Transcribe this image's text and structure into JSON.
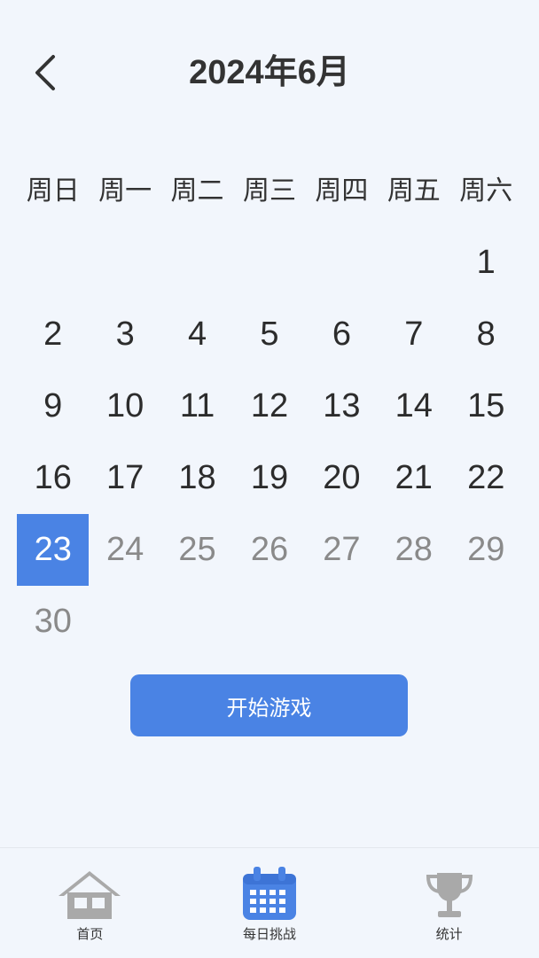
{
  "header": {
    "title": "2024年6月"
  },
  "weekdays": [
    "周日",
    "周一",
    "周二",
    "周三",
    "周四",
    "周五",
    "周六"
  ],
  "calendar": {
    "leading_blanks": 6,
    "days": [
      {
        "n": "1",
        "state": "past"
      },
      {
        "n": "2",
        "state": "past"
      },
      {
        "n": "3",
        "state": "past"
      },
      {
        "n": "4",
        "state": "past"
      },
      {
        "n": "5",
        "state": "past"
      },
      {
        "n": "6",
        "state": "past"
      },
      {
        "n": "7",
        "state": "past"
      },
      {
        "n": "8",
        "state": "past"
      },
      {
        "n": "9",
        "state": "past"
      },
      {
        "n": "10",
        "state": "past"
      },
      {
        "n": "11",
        "state": "past"
      },
      {
        "n": "12",
        "state": "past"
      },
      {
        "n": "13",
        "state": "past"
      },
      {
        "n": "14",
        "state": "past"
      },
      {
        "n": "15",
        "state": "past"
      },
      {
        "n": "16",
        "state": "past"
      },
      {
        "n": "17",
        "state": "past"
      },
      {
        "n": "18",
        "state": "past"
      },
      {
        "n": "19",
        "state": "past"
      },
      {
        "n": "20",
        "state": "past"
      },
      {
        "n": "21",
        "state": "past"
      },
      {
        "n": "22",
        "state": "past"
      },
      {
        "n": "23",
        "state": "selected"
      },
      {
        "n": "24",
        "state": "future"
      },
      {
        "n": "25",
        "state": "future"
      },
      {
        "n": "26",
        "state": "future"
      },
      {
        "n": "27",
        "state": "future"
      },
      {
        "n": "28",
        "state": "future"
      },
      {
        "n": "29",
        "state": "future"
      },
      {
        "n": "30",
        "state": "future"
      }
    ]
  },
  "start_button": {
    "label": "开始游戏"
  },
  "tabbar": {
    "home_label": "首页",
    "daily_label": "每日挑战",
    "stats_label": "统计"
  },
  "colors": {
    "accent": "#4a83e4",
    "background": "#f2f6fc",
    "text": "#2c2c2c",
    "future_text": "#8a8a8a",
    "inactive_icon": "#a9a9a9"
  },
  "icons": {
    "back": "chevron-left-icon",
    "home": "home-icon",
    "daily": "calendar-icon",
    "stats": "trophy-icon"
  }
}
